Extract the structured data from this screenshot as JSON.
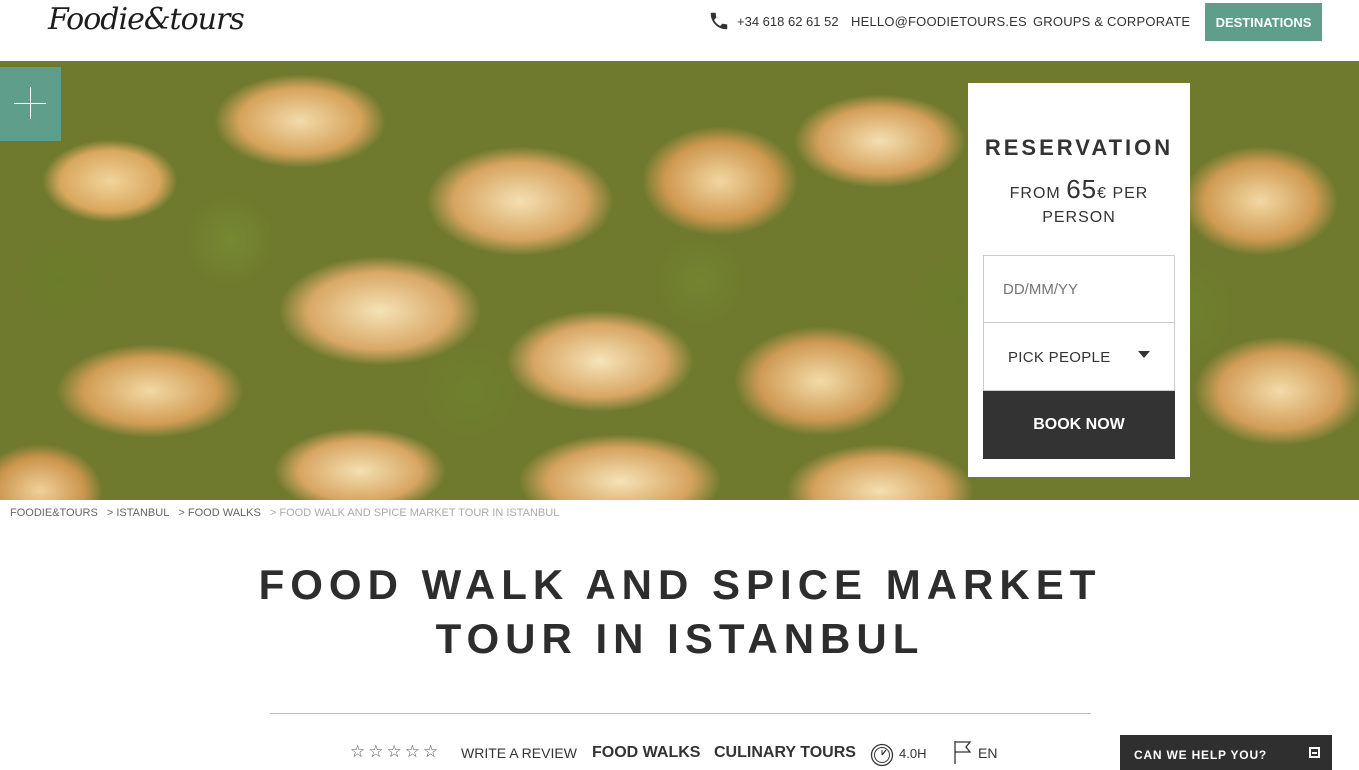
{
  "header": {
    "logo": "Foodie&tours",
    "phone": "+34 618 62 61 52",
    "email": "HELLO@FOODIETOURS.ES",
    "groups": "GROUPS & CORPORATE",
    "destinations": "DESTINATIONS",
    "accent_color": "#5e9e8b"
  },
  "reservation": {
    "title": "RESERVATION",
    "price_prefix": "FROM",
    "price_amount": "65",
    "price_suffix": "€ PER PERSON",
    "date_placeholder": "DD/MM/YY",
    "people_label": "PICK PEOPLE",
    "book_label": "BOOK NOW"
  },
  "breadcrumb": {
    "items": [
      "FOODIE&TOURS",
      "> ISTANBUL",
      "> FOOD WALKS",
      "> FOOD WALK AND SPICE MARKET TOUR IN ISTANBUL"
    ]
  },
  "tour": {
    "title": "FOOD WALK AND SPICE MARKET TOUR IN ISTANBUL",
    "stars": "☆☆☆☆☆",
    "write_review": "WRITE A REVIEW",
    "category_1": "FOOD WALKS",
    "category_2": "CULINARY TOURS",
    "duration": "4.0H",
    "language": "EN"
  },
  "help": {
    "label": "CAN WE HELP YOU?"
  }
}
